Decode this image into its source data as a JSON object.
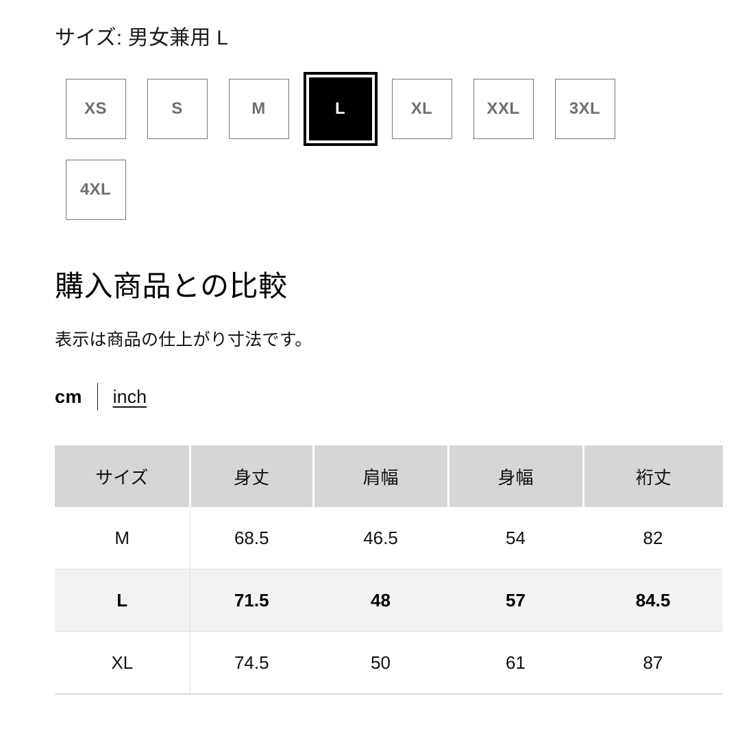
{
  "size_selector": {
    "label_prefix": "サイズ:",
    "selected_label": "男女兼用 L",
    "full_header": "サイズ: 男女兼用 L",
    "options": [
      {
        "label": "XS",
        "selected": false
      },
      {
        "label": "S",
        "selected": false
      },
      {
        "label": "M",
        "selected": false
      },
      {
        "label": "L",
        "selected": true
      },
      {
        "label": "XL",
        "selected": false
      },
      {
        "label": "XXL",
        "selected": false
      },
      {
        "label": "3XL",
        "selected": false
      },
      {
        "label": "4XL",
        "selected": false
      }
    ]
  },
  "comparison": {
    "title": "購入商品との比較",
    "note": "表示は商品の仕上がり寸法です。",
    "units": {
      "active": "cm",
      "inactive": "inch"
    }
  },
  "size_table": {
    "headers": [
      "サイズ",
      "身丈",
      "肩幅",
      "身幅",
      "裄丈"
    ],
    "rows": [
      {
        "cells": [
          "M",
          "68.5",
          "46.5",
          "54",
          "82"
        ],
        "highlight": false
      },
      {
        "cells": [
          "L",
          "71.5",
          "48",
          "57",
          "84.5"
        ],
        "highlight": true
      },
      {
        "cells": [
          "XL",
          "74.5",
          "50",
          "61",
          "87"
        ],
        "highlight": false
      }
    ]
  },
  "colors": {
    "selected_swatch_bg": "#000000",
    "swatch_border": "#767676",
    "table_header_bg": "#d6d6d6",
    "table_highlight_bg": "#f2f2f2"
  }
}
